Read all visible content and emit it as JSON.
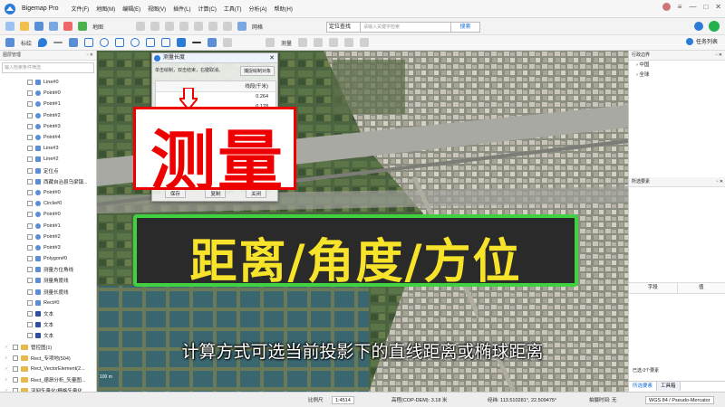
{
  "app": {
    "name": "Bigemap Pro"
  },
  "menu": [
    "文件(F)",
    "地图(M)",
    "编辑(E)",
    "视图(V)",
    "插件(L)",
    "计算(C)",
    "工具(T)",
    "分析(A)",
    "帮助(H)"
  ],
  "toolbar1": {
    "map_label": "地图",
    "grid_label": "网格",
    "search_scope": "定位查找",
    "search_placeholder": "请输入关键字检索",
    "search_button": "搜索"
  },
  "toolbar2": {
    "label": "标绘",
    "measure": "测量",
    "task_window": "任务列表"
  },
  "left_panel": {
    "title": "图层管理",
    "search_placeholder": "输入检索条件筛选",
    "items": [
      "Line#0",
      "Point#0",
      "Point#1",
      "Point#2",
      "Point#3",
      "Point#4",
      "Line#3",
      "Line#2",
      "定位点",
      "西藏自治县乌梁镇...",
      "Point#0",
      "Circle#0",
      "Point#0",
      "Point#1",
      "Point#2",
      "Point#3",
      "Polygon#0",
      "测量方位角线",
      "测量角度线",
      "测量长度线",
      "Rect#0",
      "文本",
      "文本",
      "文本"
    ],
    "groups": [
      "管控图(1)",
      "Rect_专项地(504)",
      "Rect_VectorElement(2...",
      "Rect_德昂分析_矢量图...",
      "河网矢量化(栅格矢量化..."
    ]
  },
  "dialog": {
    "title": "测量长度",
    "hint": "单击绘制，双击结束，右键取消。",
    "snap_button": "捕捉绘制对象",
    "column_header": "线段(千米)",
    "rows": [
      "0.264",
      "0.178"
    ],
    "buttons": [
      "保存",
      "复制",
      "关闭"
    ]
  },
  "overlays": {
    "title": "测量",
    "banner": "距离/角度/方位",
    "subtitle": "计算方式可选当前投影下的直线距离或椭球距离"
  },
  "right_panel": {
    "title": "行政边界",
    "items": [
      "中国",
      "全球"
    ],
    "features_title": "所选要素",
    "col_field": "字段",
    "col_value": "值",
    "count_text": "已选 0个要素",
    "tabs": [
      "所选要素",
      "工具箱"
    ]
  },
  "status": {
    "scale_label": "比例尺",
    "scale_value": "1:4514",
    "elevation": "高程(COP-DEM): 3.18 米",
    "coords": "经纬: 113.510281°, 22.509475°",
    "pitch": "拍摄时间: 无",
    "projection": "WGS 84 / Pseudo-Mercator"
  },
  "map_scale": "100 m",
  "colors": {
    "accent": "#1a6fd6",
    "measure_red": "#ee0000",
    "banner_yellow": "#f6e32a",
    "banner_border": "#3fd13f"
  }
}
